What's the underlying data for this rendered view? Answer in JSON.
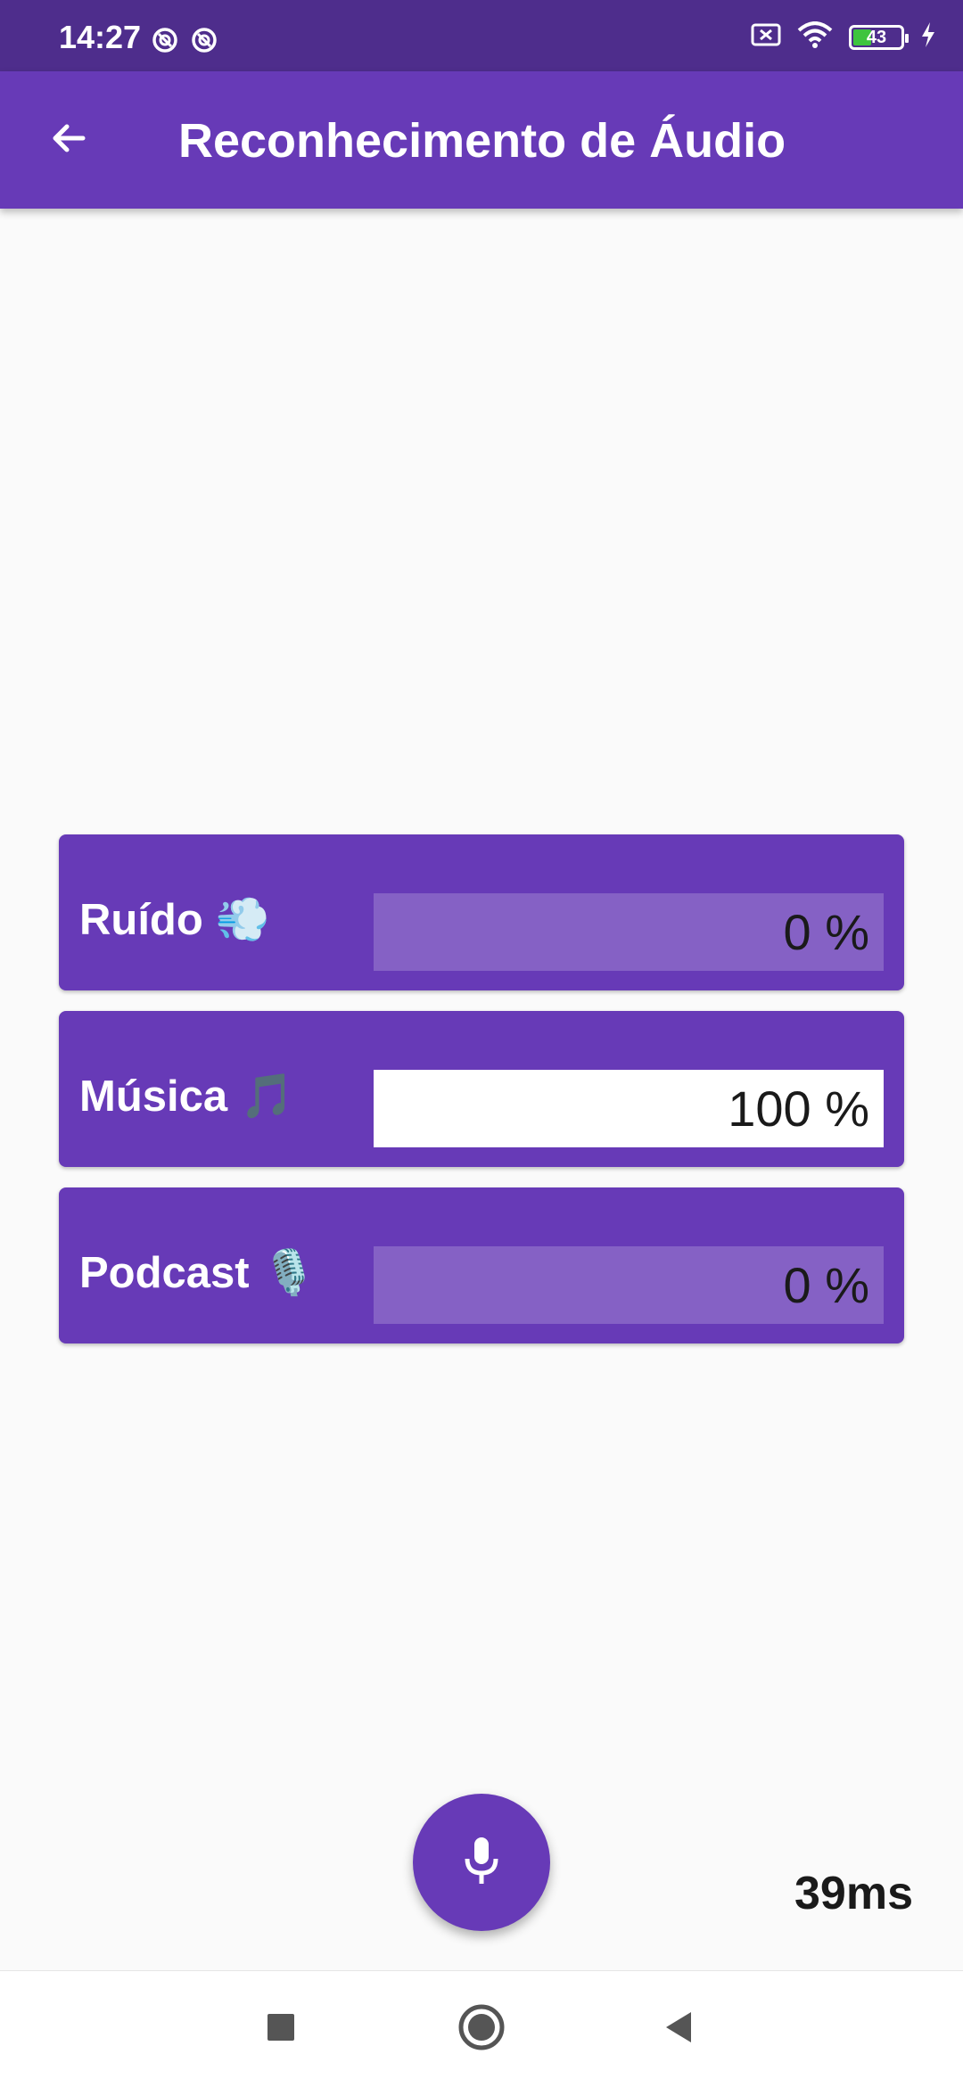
{
  "status_bar": {
    "time": "14:27",
    "battery_level": 43,
    "battery_text": "43",
    "icons": [
      "vpn-icon",
      "vpn-icon",
      "sim-error-icon",
      "wifi-icon",
      "battery-icon",
      "charging-icon"
    ]
  },
  "app_bar": {
    "title": "Reconhecimento de Áudio",
    "back_icon": "arrow-back-icon"
  },
  "results": [
    {
      "label": "Ruído",
      "emoji": "💨",
      "value": 0,
      "value_text": "0 %"
    },
    {
      "label": "Música",
      "emoji": "🎵",
      "value": 100,
      "value_text": "100 %"
    },
    {
      "label": "Podcast",
      "emoji": "🎙️",
      "value": 0,
      "value_text": "0 %"
    }
  ],
  "fab": {
    "icon": "microphone-icon"
  },
  "timing": "39ms",
  "nav_bar": {
    "icons": [
      "recents-square-icon",
      "home-circle-icon",
      "back-triangle-icon"
    ]
  },
  "colors": {
    "primary": "#673ab7",
    "status_bar": "#4e2d8c",
    "bar_track": "#8561c5",
    "bar_fill": "#ffffff",
    "background": "#fafafa"
  }
}
